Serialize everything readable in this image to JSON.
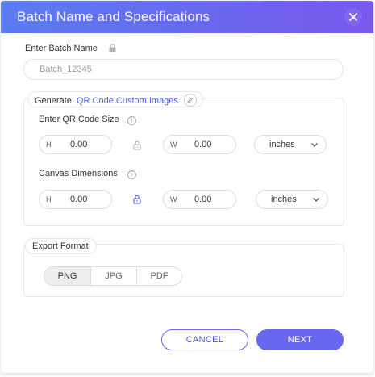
{
  "dialog": {
    "title": "Batch Name and Specifications"
  },
  "batch_name": {
    "label": "Enter Batch Name",
    "value": "Batch_12345"
  },
  "generate": {
    "prefix": "Generate:",
    "link": "QR Code Custom Images",
    "qr_size": {
      "label": "Enter QR Code Size",
      "height_prefix": "H",
      "height_value": "0.00",
      "width_prefix": "W",
      "width_value": "0.00",
      "unit": "inches"
    },
    "canvas": {
      "label": "Canvas Dimensions",
      "height_prefix": "H",
      "height_value": "0.00",
      "width_prefix": "W",
      "width_value": "0.00",
      "unit": "inches"
    }
  },
  "export": {
    "label": "Export Format",
    "options": [
      "PNG",
      "JPG",
      "PDF"
    ],
    "selected": "PNG"
  },
  "buttons": {
    "cancel": "CANCEL",
    "next": "NEXT"
  },
  "colors": {
    "accent": "#6a67ef",
    "link": "#4a63e6",
    "header_start": "#5b7cf2",
    "header_end": "#7a58ee"
  },
  "icons": {
    "close": "close-icon",
    "lock": "lock-icon",
    "info": "info-icon",
    "edit": "edit-icon",
    "chevron": "chevron-down-icon"
  }
}
